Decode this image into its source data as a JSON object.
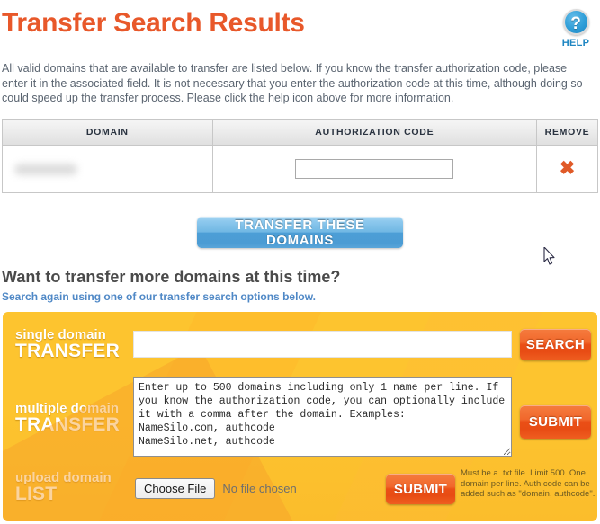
{
  "header": {
    "title": "Transfer Search Results",
    "help_icon": "question-mark-icon",
    "help_glyph": "?",
    "help_label": "HELP",
    "title_color": "#e8582a"
  },
  "intro": {
    "text": "All valid domains that are available to transfer are listed below. If you know the transfer authorization code, please enter it in the associated field. It is not necessary that you enter the authorization code at this time, although doing so could speed up the transfer process. Please click the help icon above for more information."
  },
  "results_table": {
    "columns": [
      "DOMAIN",
      "AUTHORIZATION CODE",
      "REMOVE"
    ],
    "rows": [
      {
        "domain": "",
        "domain_redacted": true,
        "auth_code_value": "",
        "auth_code_placeholder": "",
        "remove_icon": "cross-icon",
        "remove_glyph": "✖"
      }
    ]
  },
  "actions": {
    "transfer_button_label": "TRANSFER THESE DOMAINS"
  },
  "more_domains": {
    "heading": "Want to transfer more domains at this time?",
    "link_text": "Search again using one of our transfer search options below."
  },
  "search_panel": {
    "accent_color": "#fdc42f",
    "button_color": "#ea4f16",
    "single_domain": {
      "label_small": "single domain",
      "label_big": "TRANSFER",
      "input_value": "",
      "input_placeholder": "",
      "button_label": "SEARCH"
    },
    "multiple_domain": {
      "label_small": "multiple domain",
      "label_big": "TRANSFER",
      "textarea_value": "Enter up to 500 domains including only 1 name per line. If you know the authorization code, you can optionally include it with a comma after the domain. Examples:\nNameSilo.com, authcode\nNameSilo.net, authcode",
      "button_label": "SUBMIT"
    },
    "upload_list": {
      "label_small": "upload domain",
      "label_big": "LIST",
      "choose_file_label": "Choose File",
      "no_file_text": "No file chosen",
      "button_label": "SUBMIT",
      "note": "Must be a .txt file. Limit 500. One domain per line. Auth code can be added such as \"domain, authcode\"."
    }
  },
  "cursor": {
    "icon": "mouse-pointer-icon"
  }
}
